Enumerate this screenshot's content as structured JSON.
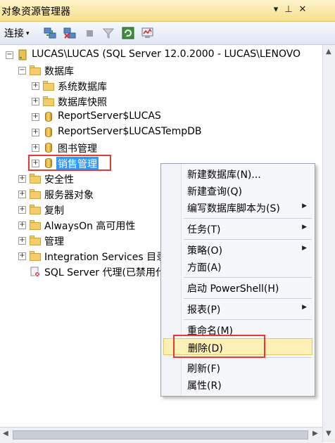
{
  "window": {
    "title": "对象资源管理器",
    "pin_glyph": "▾",
    "autohide_glyph": "⊥",
    "close_glyph": "✕"
  },
  "toolbar": {
    "connect_label": "连接",
    "connect_arrow": "▾"
  },
  "tree": {
    "server": "LUCAS\\LUCAS (SQL Server 12.0.2000 - LUCAS\\LENOVO",
    "databases_folder": "数据库",
    "nodes": [
      {
        "label": "系统数据库"
      },
      {
        "label": "数据库快照"
      },
      {
        "label": "ReportServer$LUCAS"
      },
      {
        "label": "ReportServer$LUCASTempDB"
      },
      {
        "label": "图书管理"
      },
      {
        "label": "销售管理"
      }
    ],
    "security": "安全性",
    "server_objects": "服务器对象",
    "replication": "复制",
    "alwayson": "AlwaysOn 高可用性",
    "management": "管理",
    "integration": "Integration Services 目录",
    "agent": "SQL Server 代理(已禁用代理 XP)"
  },
  "context_menu": {
    "items": [
      {
        "label": "新建数据库(N)..."
      },
      {
        "label": "新建查询(Q)"
      },
      {
        "label": "编写数据库脚本为(S)"
      },
      {
        "label": "任务(T)"
      },
      {
        "label": "策略(O)"
      },
      {
        "label": "方面(A)"
      },
      {
        "label": "启动 PowerShell(H)"
      },
      {
        "label": "报表(P)"
      },
      {
        "label": "重命名(M)"
      },
      {
        "label": "删除(D)"
      },
      {
        "label": "刷新(F)"
      },
      {
        "label": "属性(R)"
      }
    ],
    "submenu_glyph": "▶"
  },
  "colors": {
    "selection": "#3399ff",
    "highlight_box": "#e53935",
    "menu_hover": "#fdf0b7"
  }
}
